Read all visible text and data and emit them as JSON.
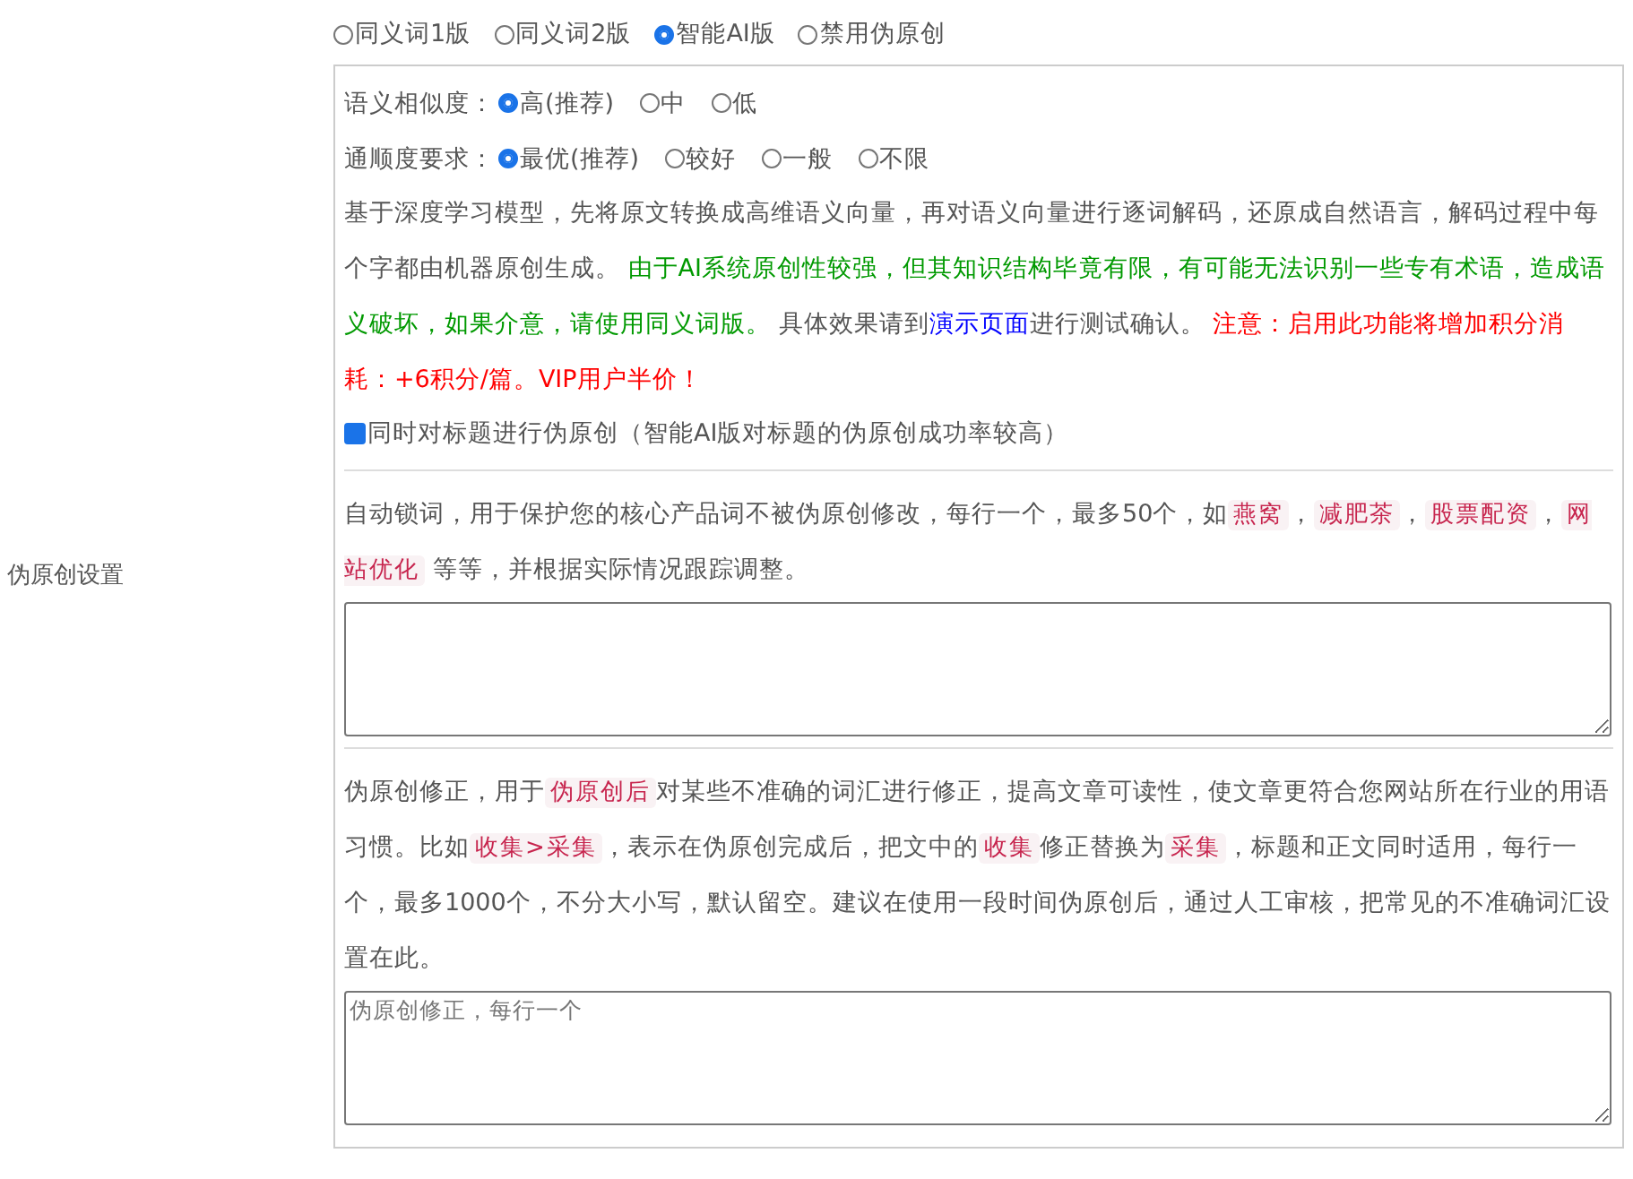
{
  "settings_label": "伪原创设置",
  "modes": [
    {
      "label": "同义词1版",
      "selected": false
    },
    {
      "label": "同义词2版",
      "selected": false
    },
    {
      "label": "智能AI版",
      "selected": true
    },
    {
      "label": "禁用伪原创",
      "selected": false
    }
  ],
  "option_groups": [
    {
      "label": "语义相似度：",
      "options": [
        {
          "label": "高(推荐)",
          "selected": true
        },
        {
          "label": "中",
          "selected": false
        },
        {
          "label": "低",
          "selected": false
        }
      ]
    },
    {
      "label": "通顺度要求：",
      "options": [
        {
          "label": "最优(推荐)",
          "selected": true
        },
        {
          "label": "较好",
          "selected": false
        },
        {
          "label": "一般",
          "selected": false
        },
        {
          "label": "不限",
          "selected": false
        }
      ]
    }
  ],
  "ai_description": [
    {
      "kind": "plain",
      "text": "基于深度学习模型，先将原文转换成高维语义向量，再对语义向量进行逐词解码，还原成自然语言，解码过程中每个字都由机器原创生成。 "
    },
    {
      "kind": "green",
      "text": "由于AI系统原创性较强，但其知识结构毕竟有限，有可能无法识别一些专有术语，造成语义破坏，如果介意，请使用同义词版。"
    },
    {
      "kind": "plain",
      "text": " 具体效果请到"
    },
    {
      "kind": "link",
      "text": "演示页面"
    },
    {
      "kind": "plain",
      "text": "进行测试确认。 "
    },
    {
      "kind": "red",
      "text": "注意：启用此功能将增加积分消耗：+6积分/篇。VIP用户半价！"
    }
  ],
  "title_option": {
    "label": "同时对标题进行伪原创（智能AI版对标题的伪原创成功率较高）",
    "checked": true
  },
  "lock_words": {
    "description": [
      {
        "kind": "plain",
        "text": "自动锁词，用于保护您的核心产品词不被伪原创修改，每行一个，最多50个，如"
      },
      {
        "kind": "code",
        "text": "燕窝"
      },
      {
        "kind": "plain",
        "text": "，"
      },
      {
        "kind": "code",
        "text": "减肥茶"
      },
      {
        "kind": "plain",
        "text": "，"
      },
      {
        "kind": "code",
        "text": "股票配资"
      },
      {
        "kind": "plain",
        "text": "，"
      },
      {
        "kind": "code",
        "text": "网站优化"
      },
      {
        "kind": "plain",
        "text": " 等等，并根据实际情况跟踪调整。"
      }
    ]
  },
  "corrections": {
    "description": [
      {
        "kind": "plain",
        "text": "伪原创修正，用于"
      },
      {
        "kind": "code",
        "text": "伪原创后"
      },
      {
        "kind": "plain",
        "text": "对某些不准确的词汇进行修正，提高文章可读性，使文章更符合您网站所在行业的用语习惯。比如"
      },
      {
        "kind": "code",
        "text": "收集>采集"
      },
      {
        "kind": "plain",
        "text": "，表示在伪原创完成后，把文中的"
      },
      {
        "kind": "code",
        "text": "收集"
      },
      {
        "kind": "plain",
        "text": "修正替换为"
      },
      {
        "kind": "code",
        "text": "采集"
      },
      {
        "kind": "plain",
        "text": "，标题和正文同时适用，每行一个，最多1000个，不分大小写，默认留空。建议在使用一段时间伪原创后，通过人工审核，把常见的不准确词汇设置在此。"
      }
    ],
    "placeholder": "伪原创修正，每行一个"
  }
}
